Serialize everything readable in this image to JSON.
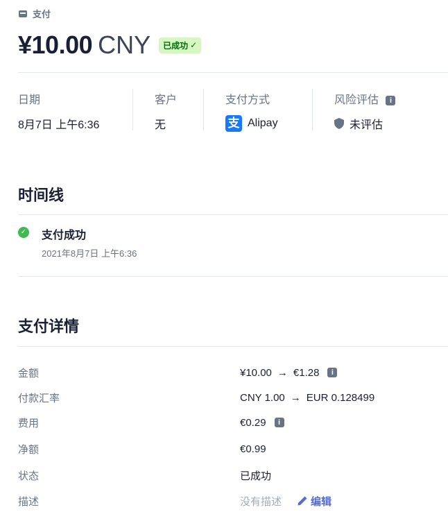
{
  "breadcrumb": {
    "label": "支付"
  },
  "header": {
    "amount": "¥10.00",
    "currency": "CNY",
    "status_badge": "已成功",
    "badge_color": "#d7f7c2"
  },
  "summary": {
    "date": {
      "label": "日期",
      "value": "8月7日 上午6:36"
    },
    "customer": {
      "label": "客户",
      "value": "无"
    },
    "payment_method": {
      "label": "支付方式",
      "value": "Alipay",
      "icon_text": "支"
    },
    "risk": {
      "label": "风险评估",
      "value": "未评估"
    }
  },
  "timeline": {
    "title": "时间线",
    "events": [
      {
        "title": "支付成功",
        "time": "2021年8月7日 上午6:36"
      }
    ]
  },
  "details": {
    "title": "支付详情",
    "rows": [
      {
        "label": "金额",
        "from": "¥10.00",
        "to": "€1.28"
      },
      {
        "label": "付款汇率",
        "from": "CNY 1.00",
        "to": "EUR 0.128499"
      },
      {
        "label": "费用",
        "value": "€0.29"
      },
      {
        "label": "净额",
        "value": "€0.99"
      },
      {
        "label": "状态",
        "value": "已成功"
      },
      {
        "label": "描述",
        "value": "没有描述",
        "edit": "编辑"
      }
    ]
  },
  "icons": {
    "info": "i",
    "arrow": "→",
    "check": "✓"
  },
  "colors": {
    "accent": "#556cd6",
    "success": "#3fb950",
    "alipay": "#1677ff"
  }
}
